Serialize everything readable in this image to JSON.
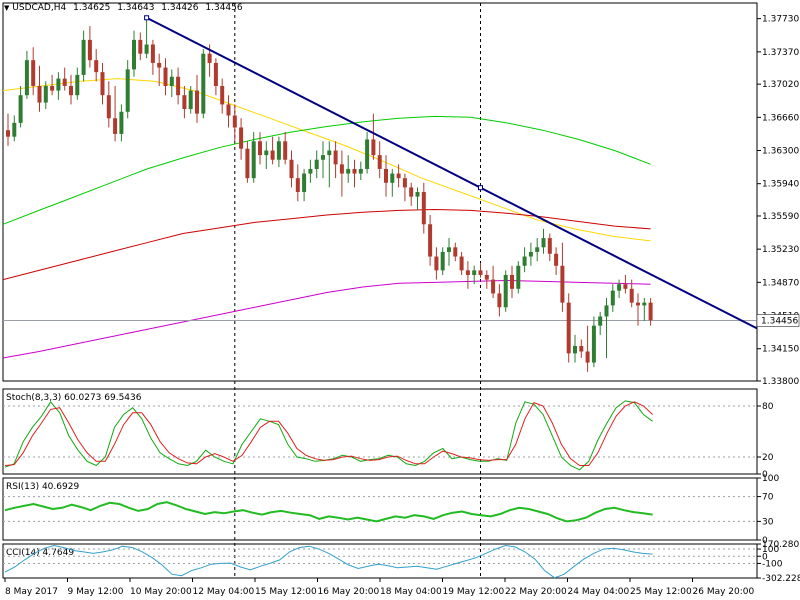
{
  "header": {
    "symbol": "USDCAD,H4",
    "open": "1.34625",
    "high": "1.34643",
    "low": "1.34426",
    "close": "1.34456"
  },
  "colors": {
    "background": "#ffffff",
    "bull": "#2e7d32",
    "bear": "#b03a2e",
    "ma_green": "#00cc00",
    "ma_yellow": "#ffd700",
    "ma_red": "#cc0000",
    "ma_magenta": "#cc00cc",
    "trendline": "#000080",
    "stoch_k": "#11aa11",
    "stoch_d": "#dd2222",
    "rsi": "#22bb22",
    "cci": "#33a0cc"
  },
  "chart_data": [
    {
      "type": "candlestick",
      "title": "USDCAD,H4",
      "ylim": [
        1.338,
        1.379
      ],
      "y_ticks": [
        "1.37730",
        "1.37370",
        "1.37020",
        "1.36660",
        "1.36300",
        "1.35940",
        "1.35590",
        "1.35230",
        "1.34870",
        "1.34510",
        "1.34150",
        "1.33800"
      ],
      "current_price_label": "1.34456",
      "x_labels": [
        "8 May 2017",
        "9 May 12:00",
        "10 May 20:00",
        "12 May 04:00",
        "15 May 12:00",
        "16 May 20:00",
        "18 May 04:00",
        "19 May 12:00",
        "22 May 20:00",
        "24 May 04:00",
        "25 May 12:00",
        "26 May 20:00"
      ],
      "candles": [
        [
          1.3652,
          1.367,
          1.3635,
          1.3645
        ],
        [
          1.3645,
          1.3668,
          1.364,
          1.366
        ],
        [
          1.366,
          1.37,
          1.3655,
          1.369
        ],
        [
          1.369,
          1.3738,
          1.3686,
          1.3728
        ],
        [
          1.3728,
          1.3742,
          1.369,
          1.37
        ],
        [
          1.37,
          1.3722,
          1.3672,
          1.3682
        ],
        [
          1.3682,
          1.3705,
          1.3675,
          1.37
        ],
        [
          1.37,
          1.3712,
          1.369,
          1.3695
        ],
        [
          1.3695,
          1.3715,
          1.3685,
          1.3708
        ],
        [
          1.3708,
          1.372,
          1.3695,
          1.37
        ],
        [
          1.37,
          1.3712,
          1.368,
          1.369
        ],
        [
          1.369,
          1.372,
          1.3685,
          1.3712
        ],
        [
          1.3712,
          1.376,
          1.3705,
          1.375
        ],
        [
          1.375,
          1.3765,
          1.372,
          1.3728
        ],
        [
          1.3728,
          1.374,
          1.3705,
          1.3715
        ],
        [
          1.3715,
          1.3725,
          1.368,
          1.369
        ],
        [
          1.369,
          1.3705,
          1.3655,
          1.3665
        ],
        [
          1.3665,
          1.37,
          1.364,
          1.3648
        ],
        [
          1.3648,
          1.368,
          1.364,
          1.3672
        ],
        [
          1.3672,
          1.3728,
          1.3665,
          1.3718
        ],
        [
          1.3718,
          1.376,
          1.371,
          1.375
        ],
        [
          1.375,
          1.3758,
          1.3728,
          1.3735
        ],
        [
          1.3735,
          1.3776,
          1.373,
          1.3745
        ],
        [
          1.3745,
          1.375,
          1.3712,
          1.3725
        ],
        [
          1.3725,
          1.3735,
          1.37,
          1.372
        ],
        [
          1.372,
          1.373,
          1.369,
          1.37
        ],
        [
          1.37,
          1.3718,
          1.3688,
          1.371
        ],
        [
          1.371,
          1.372,
          1.368,
          1.369
        ],
        [
          1.369,
          1.37,
          1.3665,
          1.3675
        ],
        [
          1.3675,
          1.37,
          1.367,
          1.3695
        ],
        [
          1.3695,
          1.3712,
          1.366,
          1.367
        ],
        [
          1.367,
          1.374,
          1.3665,
          1.3735
        ],
        [
          1.3735,
          1.3745,
          1.371,
          1.3725
        ],
        [
          1.3725,
          1.373,
          1.369,
          1.37
        ],
        [
          1.37,
          1.3708,
          1.367,
          1.368
        ],
        [
          1.368,
          1.369,
          1.3655,
          1.3668
        ],
        [
          1.3668,
          1.368,
          1.364,
          1.3655
        ],
        [
          1.3655,
          1.3665,
          1.362,
          1.3632
        ],
        [
          1.3632,
          1.364,
          1.3595,
          1.36
        ],
        [
          1.36,
          1.365,
          1.3595,
          1.364
        ],
        [
          1.364,
          1.365,
          1.3615,
          1.3625
        ],
        [
          1.3625,
          1.364,
          1.361,
          1.363
        ],
        [
          1.363,
          1.3645,
          1.3615,
          1.362
        ],
        [
          1.362,
          1.3645,
          1.3612,
          1.364
        ],
        [
          1.364,
          1.365,
          1.3615,
          1.362
        ],
        [
          1.362,
          1.363,
          1.359,
          1.36
        ],
        [
          1.36,
          1.3615,
          1.3575,
          1.3585
        ],
        [
          1.3585,
          1.361,
          1.3575,
          1.3605
        ],
        [
          1.3605,
          1.362,
          1.3595,
          1.361
        ],
        [
          1.361,
          1.363,
          1.36,
          1.362
        ],
        [
          1.362,
          1.364,
          1.36,
          1.3625
        ],
        [
          1.3625,
          1.364,
          1.359,
          1.363
        ],
        [
          1.363,
          1.364,
          1.36,
          1.3615
        ],
        [
          1.3615,
          1.363,
          1.358,
          1.3605
        ],
        [
          1.3605,
          1.3625,
          1.3595,
          1.361
        ],
        [
          1.361,
          1.362,
          1.359,
          1.3605
        ],
        [
          1.3605,
          1.3618,
          1.3598,
          1.361
        ],
        [
          1.361,
          1.365,
          1.3605,
          1.3642
        ],
        [
          1.3642,
          1.367,
          1.362,
          1.3625
        ],
        [
          1.3625,
          1.364,
          1.36,
          1.361
        ],
        [
          1.361,
          1.3625,
          1.358,
          1.3595
        ],
        [
          1.3595,
          1.361,
          1.358,
          1.3605
        ],
        [
          1.3605,
          1.3615,
          1.359,
          1.36
        ],
        [
          1.36,
          1.3605,
          1.3575,
          1.359
        ],
        [
          1.359,
          1.3595,
          1.357,
          1.358
        ],
        [
          1.358,
          1.359,
          1.3565,
          1.3585
        ],
        [
          1.3585,
          1.3595,
          1.354,
          1.355
        ],
        [
          1.355,
          1.356,
          1.3505,
          1.3515
        ],
        [
          1.3515,
          1.3525,
          1.349,
          1.35
        ],
        [
          1.35,
          1.3525,
          1.3495,
          1.352
        ],
        [
          1.352,
          1.3535,
          1.3505,
          1.3525
        ],
        [
          1.3525,
          1.353,
          1.351,
          1.3515
        ],
        [
          1.3515,
          1.352,
          1.3495,
          1.35
        ],
        [
          1.35,
          1.351,
          1.348,
          1.3495
        ],
        [
          1.3495,
          1.3505,
          1.3485,
          1.35
        ],
        [
          1.35,
          1.3508,
          1.3492,
          1.3495
        ],
        [
          1.3495,
          1.35,
          1.348,
          1.349
        ],
        [
          1.349,
          1.3505,
          1.347,
          1.3475
        ],
        [
          1.3475,
          1.3485,
          1.345,
          1.346
        ],
        [
          1.346,
          1.35,
          1.3455,
          1.3495
        ],
        [
          1.3495,
          1.3505,
          1.347,
          1.348
        ],
        [
          1.348,
          1.351,
          1.3475,
          1.3505
        ],
        [
          1.3505,
          1.3525,
          1.3498,
          1.3515
        ],
        [
          1.3515,
          1.353,
          1.3505,
          1.352
        ],
        [
          1.352,
          1.3535,
          1.351,
          1.3525
        ],
        [
          1.3525,
          1.3545,
          1.3518,
          1.3535
        ],
        [
          1.3535,
          1.354,
          1.351,
          1.3518
        ],
        [
          1.3518,
          1.3525,
          1.3495,
          1.3505
        ],
        [
          1.3505,
          1.353,
          1.3455,
          1.3465
        ],
        [
          1.3465,
          1.3475,
          1.34,
          1.341
        ],
        [
          1.341,
          1.343,
          1.34,
          1.3418
        ],
        [
          1.3418,
          1.3425,
          1.3405,
          1.3412
        ],
        [
          1.3412,
          1.344,
          1.339,
          1.34
        ],
        [
          1.34,
          1.345,
          1.3395,
          1.344
        ],
        [
          1.344,
          1.3455,
          1.343,
          1.345
        ],
        [
          1.345,
          1.347,
          1.3405,
          1.3462
        ],
        [
          1.3462,
          1.3485,
          1.3455,
          1.3478
        ],
        [
          1.3478,
          1.349,
          1.347,
          1.3485
        ],
        [
          1.3485,
          1.3495,
          1.3475,
          1.348
        ],
        [
          1.348,
          1.349,
          1.346,
          1.3465
        ],
        [
          1.3465,
          1.3475,
          1.344,
          1.3462
        ],
        [
          1.3462,
          1.347,
          1.3445,
          1.3465
        ],
        [
          1.3465,
          1.347,
          1.344,
          1.3446
        ]
      ],
      "trendline": {
        "start": {
          "bar": 22,
          "price": 1.3774
        },
        "end": {
          "bar": 112,
          "price": 1.3461
        }
      },
      "moving_averages": [
        {
          "color_key": "ma_yellow",
          "values": [
            1.3695,
            1.37,
            1.3705,
            1.3708,
            1.3705,
            1.3695,
            1.368,
            1.3665,
            1.365,
            1.3635,
            1.3618,
            1.36,
            1.3585,
            1.357,
            1.3555,
            1.3545,
            1.3537,
            1.3532
          ]
        },
        {
          "color_key": "ma_green",
          "values": [
            1.355,
            1.3565,
            1.358,
            1.3595,
            1.361,
            1.3622,
            1.3633,
            1.3642,
            1.365,
            1.3656,
            1.3661,
            1.3665,
            1.3667,
            1.3666,
            1.366,
            1.3652,
            1.3642,
            1.363,
            1.3615
          ]
        },
        {
          "color_key": "ma_red",
          "values": [
            1.349,
            1.35,
            1.351,
            1.352,
            1.353,
            1.354,
            1.3546,
            1.3552,
            1.3556,
            1.356,
            1.3563,
            1.3565,
            1.3566,
            1.3565,
            1.3562,
            1.3558,
            1.3553,
            1.3548,
            1.3545
          ]
        },
        {
          "color_key": "ma_magenta",
          "values": [
            1.3405,
            1.3412,
            1.342,
            1.3428,
            1.3436,
            1.3444,
            1.3452,
            1.346,
            1.3468,
            1.3476,
            1.3482,
            1.3486,
            1.3487,
            1.3488,
            1.3489,
            1.3488,
            1.3487,
            1.3486,
            1.3485
          ]
        }
      ]
    },
    {
      "type": "line",
      "title": "Stoch(8,3,3) 60.0273 69.5436",
      "ylim": [
        0,
        100
      ],
      "y_ticks": [
        "80",
        "20",
        "0"
      ],
      "series": [
        {
          "color_key": "stoch_k",
          "values": [
            8,
            12,
            38,
            55,
            68,
            85,
            72,
            45,
            28,
            15,
            10,
            20,
            55,
            70,
            78,
            65,
            42,
            25,
            18,
            12,
            10,
            15,
            28,
            20,
            15,
            12,
            35,
            50,
            65,
            62,
            58,
            35,
            20,
            18,
            15,
            16,
            18,
            22,
            20,
            15,
            17,
            18,
            22,
            20,
            12,
            10,
            15,
            25,
            30,
            18,
            20,
            17,
            15,
            15,
            18,
            16,
            60,
            85,
            82,
            70,
            45,
            20,
            10,
            5,
            15,
            40,
            60,
            78,
            86,
            84,
            70,
            62
          ]
        },
        {
          "color_key": "stoch_d",
          "values": [
            10,
            11,
            25,
            45,
            60,
            76,
            78,
            60,
            40,
            25,
            15,
            15,
            35,
            58,
            72,
            72,
            58,
            38,
            25,
            18,
            13,
            12,
            20,
            24,
            20,
            15,
            22,
            38,
            55,
            62,
            62,
            48,
            30,
            22,
            18,
            16,
            17,
            20,
            21,
            18,
            16,
            17,
            20,
            21,
            16,
            12,
            12,
            20,
            27,
            24,
            20,
            19,
            17,
            16,
            17,
            17,
            35,
            65,
            84,
            80,
            60,
            35,
            18,
            10,
            10,
            25,
            48,
            68,
            80,
            85,
            80,
            70
          ]
        }
      ]
    },
    {
      "type": "line",
      "title": "RSI(13) 40.6929",
      "ylim": [
        0,
        100
      ],
      "y_ticks": [
        "100",
        "70",
        "30",
        "0"
      ],
      "series": [
        {
          "color_key": "rsi",
          "values": [
            48,
            52,
            55,
            58,
            54,
            50,
            52,
            57,
            53,
            48,
            55,
            60,
            58,
            52,
            47,
            50,
            58,
            61,
            56,
            50,
            46,
            42,
            45,
            43,
            46,
            48,
            44,
            41,
            45,
            47,
            44,
            42,
            40,
            34,
            38,
            36,
            33,
            36,
            33,
            30,
            34,
            38,
            36,
            40,
            38,
            34,
            40,
            44,
            46,
            42,
            40,
            38,
            42,
            48,
            52,
            50,
            46,
            42,
            35,
            30,
            32,
            36,
            44,
            50,
            52,
            48,
            45,
            43,
            41
          ]
        }
      ]
    },
    {
      "type": "line",
      "title": "CCI(14) 4.7649",
      "ylim": [
        -302.228,
        170.2805
      ],
      "y_ticks": [
        "170.2805",
        "100",
        "0",
        "-100",
        "-302.228"
      ],
      "series": [
        {
          "color_key": "cci",
          "values": [
            -220,
            -150,
            -50,
            40,
            110,
            150,
            120,
            80,
            60,
            40,
            60,
            90,
            140,
            120,
            60,
            -20,
            -120,
            -250,
            -270,
            -200,
            -160,
            -110,
            -100,
            -95,
            -150,
            -190,
            -140,
            -100,
            -50,
            60,
            120,
            140,
            100,
            40,
            -40,
            -120,
            -170,
            -140,
            -110,
            -130,
            -160,
            -150,
            -140,
            -160,
            -180,
            -140,
            -100,
            -60,
            -20,
            40,
            100,
            150,
            130,
            60,
            -40,
            -200,
            -300,
            -250,
            -140,
            -40,
            40,
            100,
            110,
            90,
            60,
            40,
            30
          ]
        }
      ]
    }
  ]
}
